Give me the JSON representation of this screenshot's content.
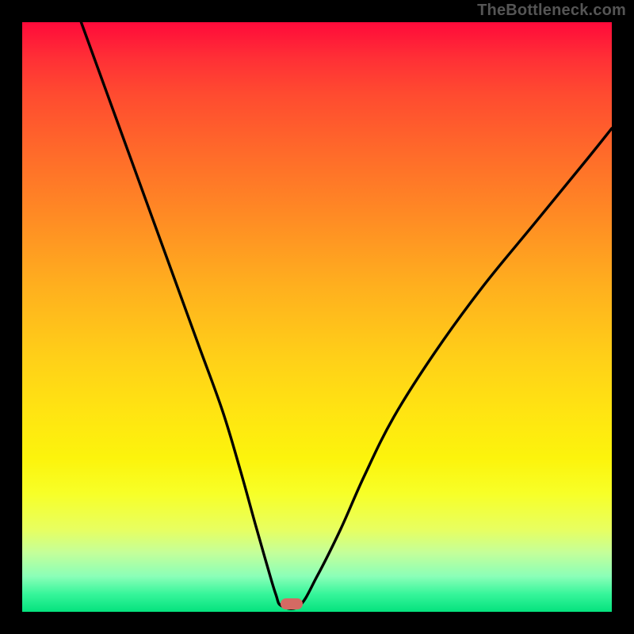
{
  "watermark": "TheBottleneck.com",
  "chart_data": {
    "type": "line",
    "title": "",
    "xlabel": "",
    "ylabel": "",
    "xlim": [
      0,
      100
    ],
    "ylim": [
      0,
      100
    ],
    "grid": false,
    "legend": false,
    "series": [
      {
        "name": "bottleneck-curve",
        "x": [
          10,
          14,
          18,
          22,
          26,
          30,
          34,
          37,
          39.5,
          41.5,
          43,
          44,
          47,
          50,
          54,
          58,
          63,
          70,
          78,
          87,
          96,
          100
        ],
        "values": [
          100,
          89,
          78,
          67,
          56,
          45,
          34,
          24,
          15,
          8,
          3,
          1,
          1,
          6,
          14,
          23,
          33,
          44,
          55,
          66,
          77,
          82
        ]
      }
    ],
    "marker": {
      "x": 45.7,
      "y": 1.4,
      "label": "optimal-point"
    },
    "background_gradient": {
      "orientation": "vertical",
      "stops": [
        {
          "pos": 0.0,
          "color": "#ff0a3a"
        },
        {
          "pos": 0.33,
          "color": "#ff8b24"
        },
        {
          "pos": 0.66,
          "color": "#ffe412"
        },
        {
          "pos": 0.9,
          "color": "#c4ff9a"
        },
        {
          "pos": 1.0,
          "color": "#05e27e"
        }
      ]
    }
  }
}
